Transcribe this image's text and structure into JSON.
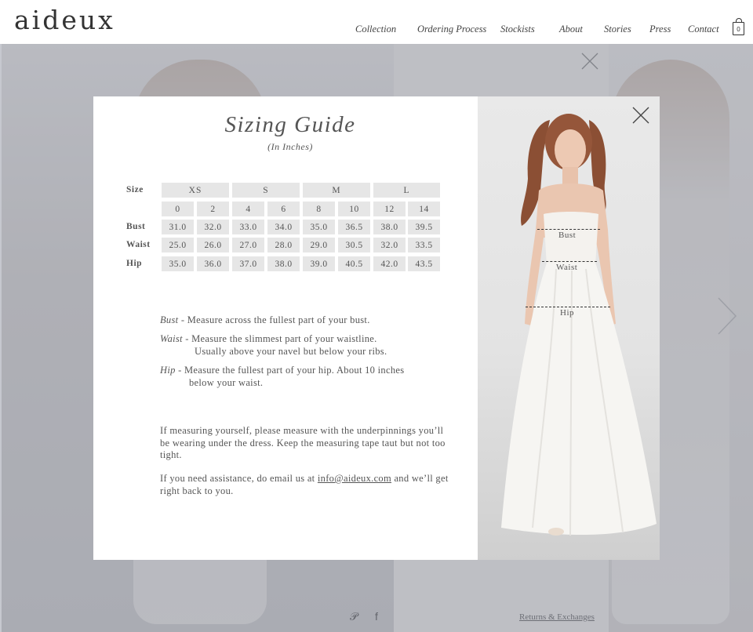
{
  "header": {
    "logo": "aideux",
    "nav": [
      "Collection",
      "Ordering Process",
      "Stockists",
      "About",
      "Stories",
      "Press",
      "Contact"
    ],
    "cart_count": "0"
  },
  "background": {
    "returns_link": "Returns & Exchanges",
    "social_icons": [
      "pinterest-icon",
      "facebook-icon"
    ]
  },
  "modal": {
    "title": "Sizing Guide",
    "subtitle": "(In Inches)",
    "table": {
      "row_labels": [
        "Size",
        "Bust",
        "Waist",
        "Hip"
      ],
      "size_groups": [
        "XS",
        "S",
        "M",
        "L"
      ],
      "numeric_sizes": [
        "0",
        "2",
        "4",
        "6",
        "8",
        "10",
        "12",
        "14"
      ],
      "bust": [
        "31.0",
        "32.0",
        "33.0",
        "34.0",
        "35.0",
        "36.5",
        "38.0",
        "39.5"
      ],
      "waist": [
        "25.0",
        "26.0",
        "27.0",
        "28.0",
        "29.0",
        "30.5",
        "32.0",
        "33.5"
      ],
      "hip": [
        "35.0",
        "36.0",
        "37.0",
        "38.0",
        "39.0",
        "40.5",
        "42.0",
        "43.5"
      ]
    },
    "descriptions": {
      "bust_term": "Bust",
      "bust_text": " - Measure across the fullest part of your bust.",
      "waist_term": "Waist",
      "waist_text": " - Measure the slimmest part of your waistline.",
      "waist_text2": "Usually above your navel but below your ribs.",
      "hip_term": "Hip",
      "hip_text": " - Measure the fullest part of your hip. About 10 inches",
      "hip_text2": "below your waist."
    },
    "note1": "If measuring yourself, please measure with the underpinnings you’ll be wearing under the dress. Keep the measuring tape taut but not too tight.",
    "note2_prefix": "If you need assistance, do email us at ",
    "email": "info@aideux.com",
    "note2_suffix": " and we’ll get right back to you.",
    "photo_labels": {
      "bust": "Bust",
      "waist": "Waist",
      "hip": "Hip"
    }
  },
  "colors": {
    "overlay": "#787c8c",
    "cell_bg": "#e6e6e6",
    "text": "#555555"
  }
}
